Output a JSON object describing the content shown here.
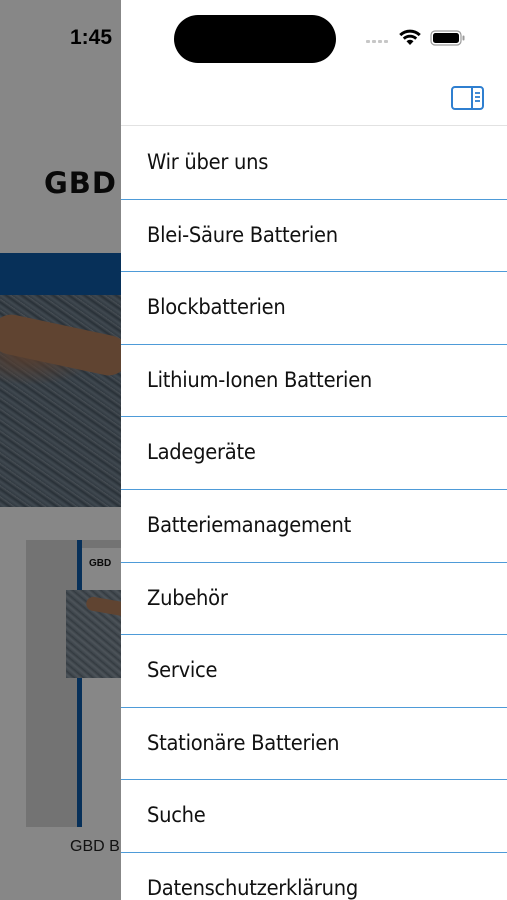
{
  "status_bar": {
    "time": "1:45"
  },
  "background_page": {
    "logo_text": "GBD",
    "thumbnail_logo": "GBD",
    "caption": "GBD B"
  },
  "drawer": {
    "toggle_icon": "sidebar-toggle-icon",
    "accent_color": "#2f7fd0",
    "divider_color": "#4e9bd8",
    "menu": [
      {
        "label": "Wir über uns"
      },
      {
        "label": "Blei-Säure Batterien"
      },
      {
        "label": "Blockbatterien"
      },
      {
        "label": "Lithium-Ionen Batterien"
      },
      {
        "label": "Ladegeräte"
      },
      {
        "label": "Batteriemanagement"
      },
      {
        "label": "Zubehör"
      },
      {
        "label": "Service"
      },
      {
        "label": "Stationäre Batterien"
      },
      {
        "label": "Suche"
      },
      {
        "label": "Datenschutzerklärung"
      }
    ]
  }
}
